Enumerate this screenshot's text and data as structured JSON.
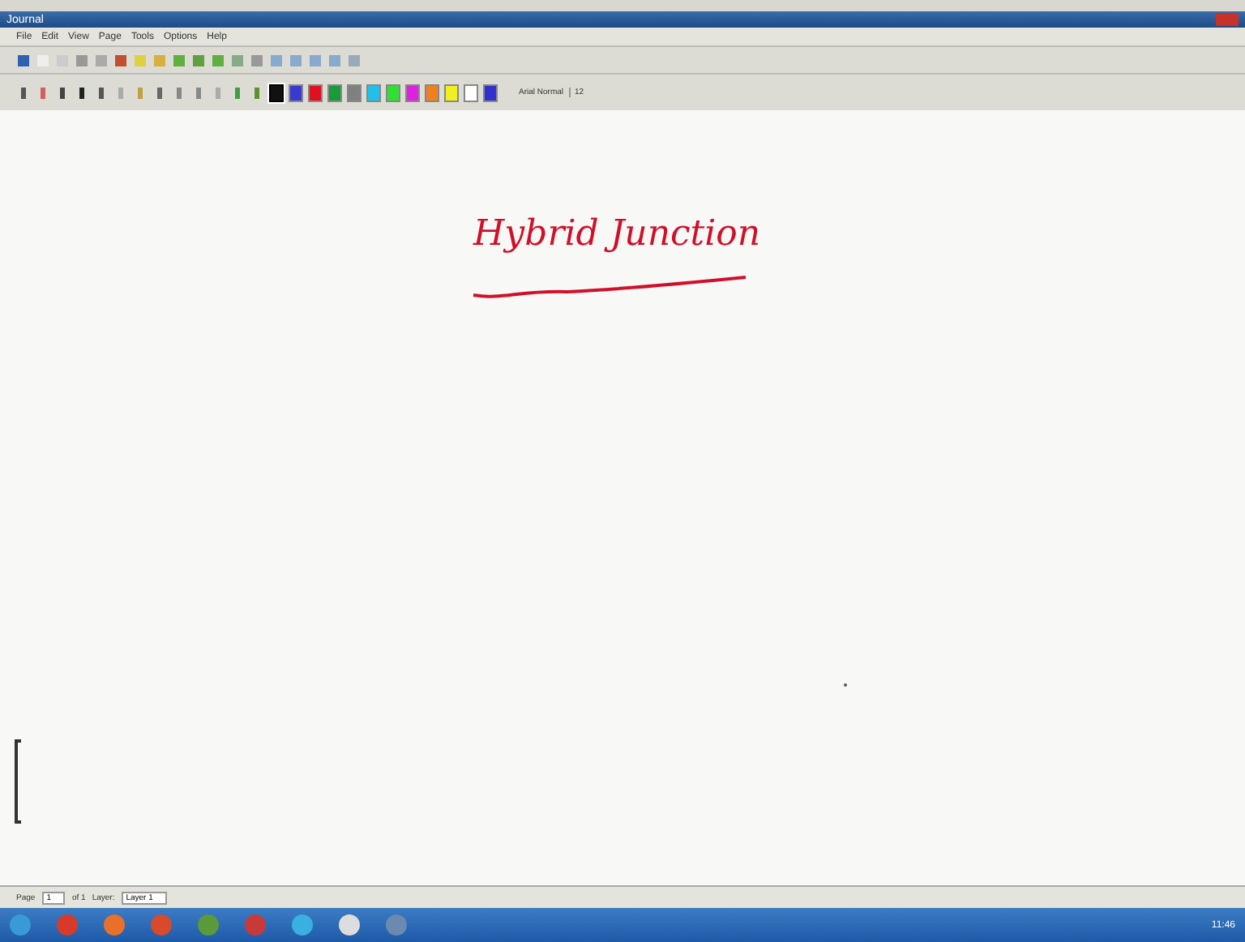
{
  "window": {
    "title": "Journal"
  },
  "menu": [
    "File",
    "Edit",
    "View",
    "Page",
    "Tools",
    "Options",
    "Help"
  ],
  "palette": [
    {
      "color": "#111111",
      "selected": true
    },
    {
      "color": "#3a3ad0",
      "selected": false
    },
    {
      "color": "#e01020",
      "selected": false
    },
    {
      "color": "#1a9a3a",
      "selected": false
    },
    {
      "color": "#808080",
      "selected": false
    },
    {
      "color": "#20c0e8",
      "selected": false
    },
    {
      "color": "#30e030",
      "selected": false
    },
    {
      "color": "#e020e0",
      "selected": false
    },
    {
      "color": "#f08020",
      "selected": false
    },
    {
      "color": "#f0f020",
      "selected": false
    },
    {
      "color": "#ffffff",
      "selected": false
    },
    {
      "color": "#3030d0",
      "selected": false
    }
  ],
  "font": {
    "name": "Arial Normal",
    "size": "12"
  },
  "canvas": {
    "heading": "Hybrid Junction"
  },
  "status_bar": {
    "page_label": "Page",
    "page": "1",
    "of": "of 1",
    "layer_label": "Layer:",
    "layer": "Layer 1"
  },
  "taskbar": {
    "time": "11:46"
  }
}
